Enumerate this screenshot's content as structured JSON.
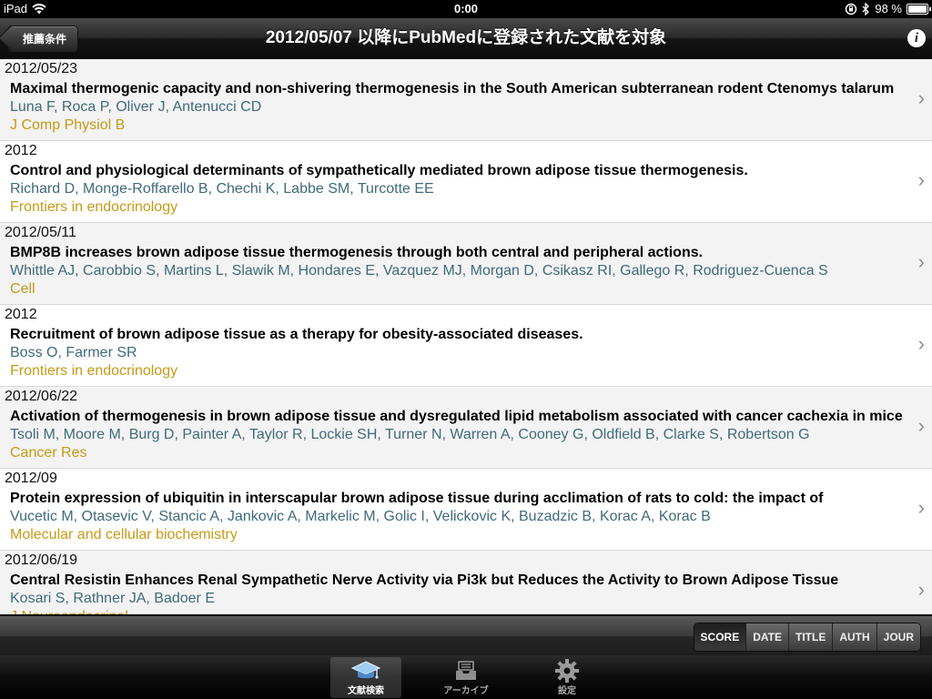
{
  "status": {
    "device": "iPad",
    "time": "0:00",
    "battery": "98 %",
    "battery_level": 0.98
  },
  "nav": {
    "back_label": "推薦条件",
    "title": "2012/05/07 以降にPubMedに登録された文献を対象"
  },
  "articles": [
    {
      "date": "2012/05/23",
      "title": "Maximal thermogenic capacity and non-shivering thermogenesis in the South American subterranean rodent Ctenomys talarum",
      "authors": "Luna F, Roca P, Oliver J, Antenucci CD",
      "journal": "J Comp Physiol B"
    },
    {
      "date": "2012",
      "title": "Control and physiological determinants of sympathetically mediated brown adipose tissue thermogenesis.",
      "authors": "Richard D, Monge-Roffarello B, Chechi K, Labbe SM, Turcotte EE",
      "journal": "Frontiers in endocrinology"
    },
    {
      "date": "2012/05/11",
      "title": "BMP8B increases brown adipose tissue thermogenesis through both central and peripheral actions.",
      "authors": "Whittle AJ, Carobbio S, Martins L, Slawik M, Hondares E, Vazquez MJ, Morgan D, Csikasz RI, Gallego R, Rodriguez-Cuenca S",
      "journal": "Cell"
    },
    {
      "date": "2012",
      "title": "Recruitment of brown adipose tissue as a therapy for obesity-associated diseases.",
      "authors": "Boss O, Farmer SR",
      "journal": "Frontiers in endocrinology"
    },
    {
      "date": "2012/06/22",
      "title": "Activation of thermogenesis in brown adipose tissue and dysregulated lipid metabolism associated with cancer cachexia in mice",
      "authors": "Tsoli M, Moore M, Burg D, Painter A, Taylor R, Lockie SH, Turner N, Warren A, Cooney G, Oldfield B, Clarke S, Robertson G",
      "journal": "Cancer Res"
    },
    {
      "date": "2012/09",
      "title": "Protein expression of ubiquitin in interscapular brown adipose tissue during acclimation of rats to cold: the impact of",
      "authors": "Vucetic M, Otasevic V, Stancic A, Jankovic A, Markelic M, Golic I, Velickovic K, Buzadzic B, Korac A, Korac B",
      "journal": "Molecular and cellular biochemistry"
    },
    {
      "date": "2012/06/19",
      "title": "Central Resistin Enhances Renal Sympathetic Nerve Activity via Pi3k but Reduces the Activity to Brown Adipose Tissue",
      "authors": "Kosari S, Rathner JA, Badoer E",
      "journal": "J Neuroendocrinol"
    }
  ],
  "sort": {
    "options": [
      "SCORE",
      "DATE",
      "TITLE",
      "AUTH",
      "JOUR"
    ],
    "selected": "SCORE"
  },
  "tabs": [
    {
      "label": "文献検索",
      "icon": "graduation-cap-icon",
      "selected": true
    },
    {
      "label": "アーカイブ",
      "icon": "archive-tray-icon",
      "selected": false
    },
    {
      "label": "設定",
      "icon": "gear-icon",
      "selected": false
    }
  ],
  "colors": {
    "authors": "#3f6a7a",
    "journal": "#c49a17",
    "row_alt": "#f3f3f3"
  }
}
